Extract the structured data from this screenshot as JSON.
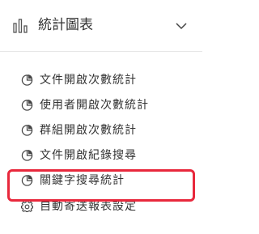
{
  "header": {
    "icon": "bar-chart-icon",
    "title": "統計圖表",
    "toggle_icon": "chevron-down-icon"
  },
  "menu": {
    "items": [
      {
        "icon": "pie-chart-icon",
        "label": "文件開啟次數統計"
      },
      {
        "icon": "pie-chart-icon",
        "label": "使用者開啟次數統計"
      },
      {
        "icon": "pie-chart-icon",
        "label": "群組開啟次數統計"
      },
      {
        "icon": "pie-chart-icon",
        "label": "文件開啟紀錄搜尋"
      },
      {
        "icon": "pie-chart-icon",
        "label": "關鍵字搜尋統計"
      },
      {
        "icon": "gear-icon",
        "label": "自動寄送報表設定",
        "highlighted": true
      }
    ]
  },
  "colors": {
    "highlight_border": "#e8283c",
    "text": "#333333",
    "divider": "#e6e6e6"
  }
}
